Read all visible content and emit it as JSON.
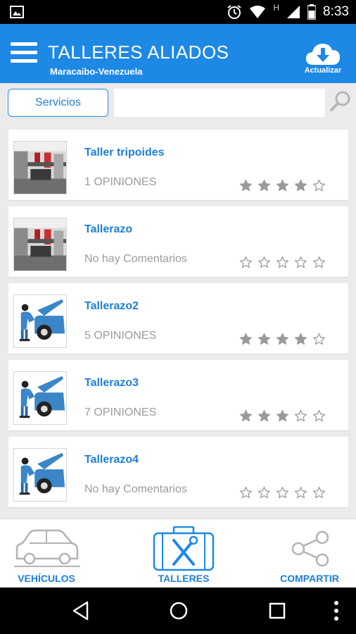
{
  "status_bar": {
    "time": "8:33",
    "network_letter": "H"
  },
  "header": {
    "title": "TALLERES ALIADOS",
    "subtitle": "Maracaibo-Venezuela",
    "update_label": "Actualizar",
    "color": "#1e88e5"
  },
  "search": {
    "services_button": "Servicios",
    "value": "",
    "placeholder": ""
  },
  "workshops": [
    {
      "name": "Taller tripoides",
      "opinions": "1 OPINIONES",
      "rating": 4,
      "image": "garage-photo"
    },
    {
      "name": "Tallerazo",
      "opinions": "No hay Comentarios",
      "rating": 0,
      "image": "garage-photo"
    },
    {
      "name": "Tallerazo2",
      "opinions": "5 OPINIONES",
      "rating": 4,
      "image": "mechanic-icon"
    },
    {
      "name": "Tallerazo3",
      "opinions": "7 OPINIONES",
      "rating": 3,
      "image": "mechanic-icon"
    },
    {
      "name": "Tallerazo4",
      "opinions": "No hay Comentarios",
      "rating": 0,
      "image": "mechanic-icon"
    }
  ],
  "tabs": [
    {
      "label": "VEHÍCULOS",
      "icon": "car-icon"
    },
    {
      "label": "TALLERES",
      "icon": "toolbox-icon",
      "active": true
    },
    {
      "label": "COMPARTIR",
      "icon": "share-icon"
    }
  ],
  "colors": {
    "accent": "#1e88e5",
    "link": "#1e7fd6",
    "muted": "#9b9b9b",
    "star": "#9a9a9a"
  }
}
